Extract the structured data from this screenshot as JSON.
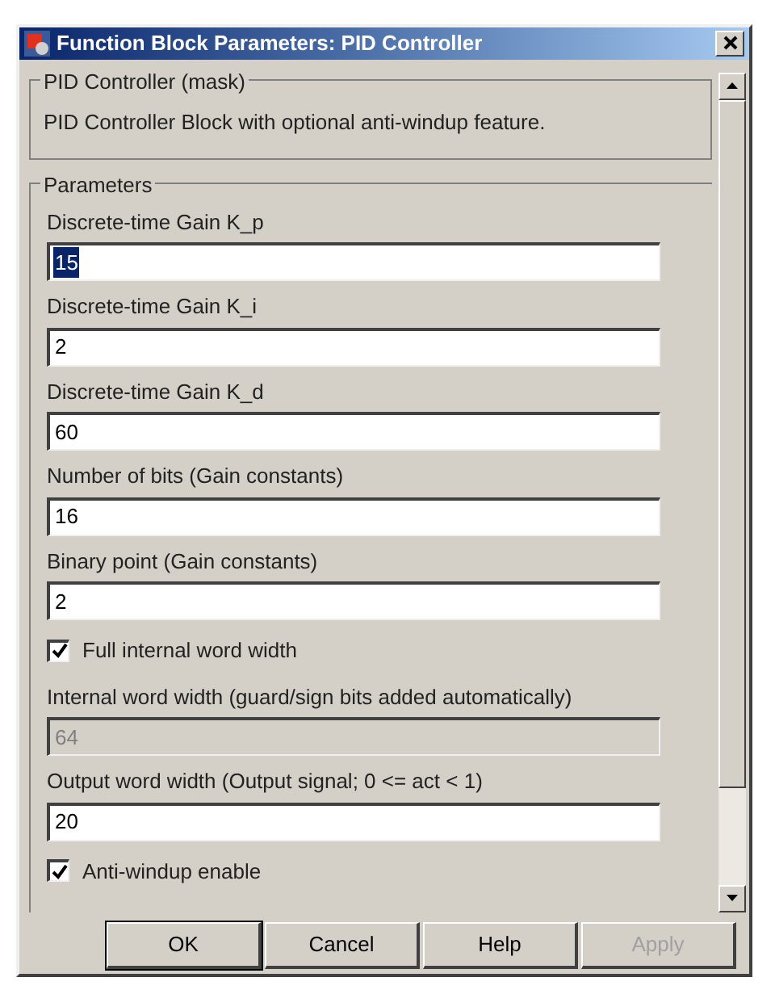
{
  "window": {
    "title": "Function Block Parameters: PID Controller"
  },
  "mask_group": {
    "title": "PID Controller (mask)",
    "description": "PID Controller Block with optional anti-windup feature."
  },
  "parameters": {
    "title": "Parameters",
    "items": [
      {
        "kind": "field",
        "label": "Discrete-time Gain K_p",
        "value": "15",
        "text_selected": true,
        "disabled": false
      },
      {
        "kind": "field",
        "label": "Discrete-time Gain K_i",
        "value": "2",
        "text_selected": false,
        "disabled": false
      },
      {
        "kind": "field",
        "label": "Discrete-time Gain K_d",
        "value": "60",
        "text_selected": false,
        "disabled": false
      },
      {
        "kind": "field",
        "label": "Number of bits (Gain constants)",
        "value": "16",
        "text_selected": false,
        "disabled": false
      },
      {
        "kind": "field",
        "label": "Binary point (Gain constants)",
        "value": "2",
        "text_selected": false,
        "disabled": false
      },
      {
        "kind": "checkbox",
        "label": "Full internal word width",
        "checked": true
      },
      {
        "kind": "field",
        "label": "Internal word width (guard/sign bits added automatically)",
        "value": "64",
        "text_selected": false,
        "disabled": true
      },
      {
        "kind": "field",
        "label": "Output word width (Output signal; 0 <= act < 1)",
        "value": "20",
        "text_selected": false,
        "disabled": false
      },
      {
        "kind": "checkbox",
        "label": "Anti-windup enable",
        "checked": true
      }
    ]
  },
  "buttons": [
    {
      "label": "OK",
      "default": true,
      "disabled": false
    },
    {
      "label": "Cancel",
      "default": false,
      "disabled": false
    },
    {
      "label": "Help",
      "default": false,
      "disabled": false
    },
    {
      "label": "Apply",
      "default": false,
      "disabled": true
    }
  ]
}
